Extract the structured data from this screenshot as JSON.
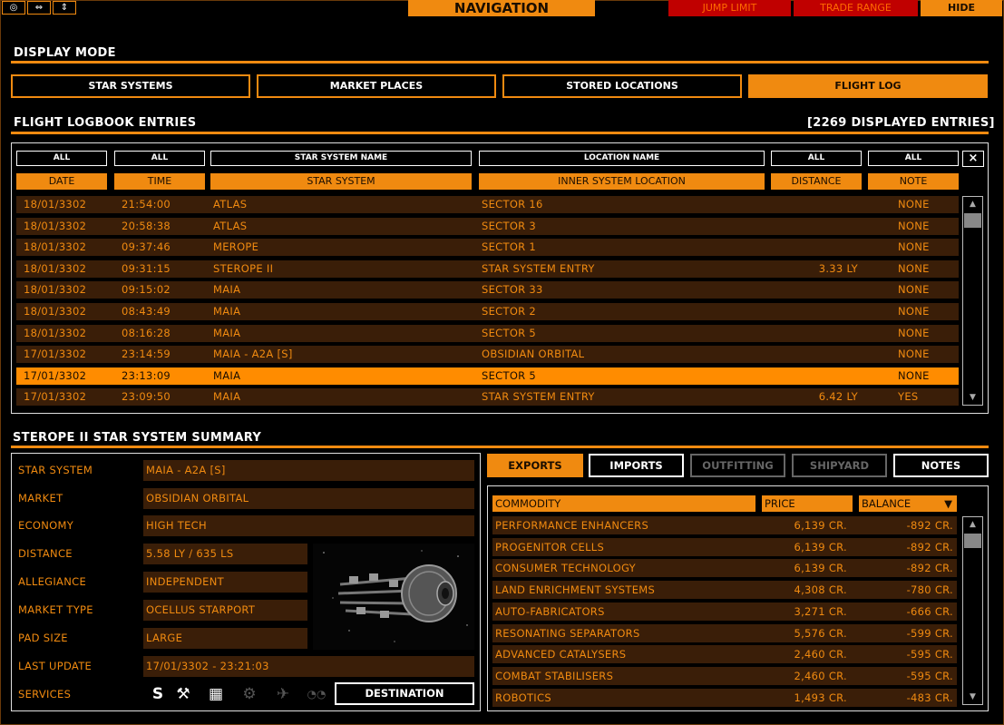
{
  "titlebar": {
    "title": "NAVIGATION",
    "jump_limit": "JUMP LIMIT",
    "trade_range": "TRADE RANGE",
    "hide": "HIDE",
    "win_icons": [
      "◎",
      "⇔",
      "⇕"
    ]
  },
  "display_mode": {
    "heading": "DISPLAY MODE",
    "buttons": [
      "STAR SYSTEMS",
      "MARKET PLACES",
      "STORED LOCATIONS",
      "FLIGHT LOG"
    ],
    "active": "FLIGHT LOG"
  },
  "logbook": {
    "heading": "FLIGHT LOGBOOK ENTRIES",
    "count": "[2269 DISPLAYED ENTRIES]",
    "filters": {
      "date": "ALL",
      "time": "ALL",
      "system": "STAR SYSTEM NAME",
      "location": "LOCATION NAME",
      "distance": "ALL",
      "note": "ALL",
      "clear": "×"
    },
    "columns": {
      "date": "DATE",
      "time": "TIME",
      "system": "STAR SYSTEM",
      "location": "INNER SYSTEM LOCATION",
      "distance": "DISTANCE",
      "note": "NOTE"
    },
    "rows": [
      {
        "date": "18/01/3302",
        "time": "21:54:00",
        "system": "ATLAS",
        "location": "SECTOR 16",
        "distance": "",
        "note": "NONE"
      },
      {
        "date": "18/01/3302",
        "time": "20:58:38",
        "system": "ATLAS",
        "location": "SECTOR 3",
        "distance": "",
        "note": "NONE"
      },
      {
        "date": "18/01/3302",
        "time": "09:37:46",
        "system": "MEROPE",
        "location": "SECTOR 1",
        "distance": "",
        "note": "NONE"
      },
      {
        "date": "18/01/3302",
        "time": "09:31:15",
        "system": "STEROPE II",
        "location": "STAR SYSTEM ENTRY",
        "distance": "3.33 LY",
        "note": "NONE"
      },
      {
        "date": "18/01/3302",
        "time": "09:15:02",
        "system": "MAIA",
        "location": "SECTOR 33",
        "distance": "",
        "note": "NONE"
      },
      {
        "date": "18/01/3302",
        "time": "08:43:49",
        "system": "MAIA",
        "location": "SECTOR 2",
        "distance": "",
        "note": "NONE"
      },
      {
        "date": "18/01/3302",
        "time": "08:16:28",
        "system": "MAIA",
        "location": "SECTOR 5",
        "distance": "",
        "note": "NONE"
      },
      {
        "date": "17/01/3302",
        "time": "23:14:59",
        "system": "MAIA - A2A [S]",
        "location": "OBSIDIAN ORBITAL",
        "distance": "",
        "note": "NONE"
      },
      {
        "date": "17/01/3302",
        "time": "23:13:09",
        "system": "MAIA",
        "location": "SECTOR 5",
        "distance": "",
        "note": "NONE"
      },
      {
        "date": "17/01/3302",
        "time": "23:09:50",
        "system": "MAIA",
        "location": "STAR SYSTEM ENTRY",
        "distance": "6.42 LY",
        "note": "YES"
      }
    ],
    "selected_index": 8
  },
  "summary": {
    "heading": "STEROPE II STAR SYSTEM SUMMARY",
    "fields": [
      {
        "label": "STAR SYSTEM",
        "value": "MAIA - A2A [S]"
      },
      {
        "label": "MARKET",
        "value": "OBSIDIAN ORBITAL"
      },
      {
        "label": "ECONOMY",
        "value": "HIGH TECH"
      },
      {
        "label": "DISTANCE",
        "value": "5.58 LY / 635 LS"
      },
      {
        "label": "ALLEGIANCE",
        "value": "INDEPENDENT"
      },
      {
        "label": "MARKET TYPE",
        "value": "OCELLUS STARPORT"
      },
      {
        "label": "PAD SIZE",
        "value": "LARGE"
      },
      {
        "label": "LAST UPDATE",
        "value": "17/01/3302 - 23:21:03"
      }
    ],
    "services_label": "SERVICES",
    "services": [
      {
        "icon": "S",
        "name": "shipyard-s-icon",
        "active": true
      },
      {
        "icon": "⚒",
        "name": "repair-tools-icon",
        "active": true
      },
      {
        "icon": "▦",
        "name": "market-icon",
        "active": true
      },
      {
        "icon": "⚙",
        "name": "outfitting-gear-icon",
        "active": false
      },
      {
        "icon": "✈",
        "name": "ship-icon",
        "active": false
      },
      {
        "icon": "◔◔",
        "name": "black-market-glasses-icon",
        "active": false
      }
    ],
    "destination": "DESTINATION"
  },
  "market": {
    "tabs": [
      "EXPORTS",
      "IMPORTS",
      "OUTFITTING",
      "SHIPYARD",
      "NOTES"
    ],
    "active_tab": "EXPORTS",
    "disabled_tabs": [
      "OUTFITTING",
      "SHIPYARD"
    ],
    "columns": {
      "commodity": "COMMODITY",
      "price": "PRICE",
      "balance": "BALANCE",
      "sort_icon": "▼"
    },
    "rows": [
      {
        "commodity": "PERFORMANCE ENHANCERS",
        "price": "6,139 CR.",
        "balance": "-892 CR."
      },
      {
        "commodity": "PROGENITOR CELLS",
        "price": "6,139 CR.",
        "balance": "-892 CR."
      },
      {
        "commodity": "CONSUMER TECHNOLOGY",
        "price": "6,139 CR.",
        "balance": "-892 CR."
      },
      {
        "commodity": "LAND ENRICHMENT SYSTEMS",
        "price": "4,308 CR.",
        "balance": "-780 CR."
      },
      {
        "commodity": "AUTO-FABRICATORS",
        "price": "3,271 CR.",
        "balance": "-666 CR."
      },
      {
        "commodity": "RESONATING SEPARATORS",
        "price": "5,576 CR.",
        "balance": "-599 CR."
      },
      {
        "commodity": "ADVANCED CATALYSERS",
        "price": "2,460 CR.",
        "balance": "-595 CR."
      },
      {
        "commodity": "COMBAT STABILISERS",
        "price": "2,460 CR.",
        "balance": "-595 CR."
      },
      {
        "commodity": "ROBOTICS",
        "price": "1,493 CR.",
        "balance": "-483 CR."
      }
    ]
  },
  "colors": {
    "accent": "#f08a10",
    "row_bg": "#3a1e08",
    "selected_row": "#ff8c00",
    "red": "#c00000"
  }
}
